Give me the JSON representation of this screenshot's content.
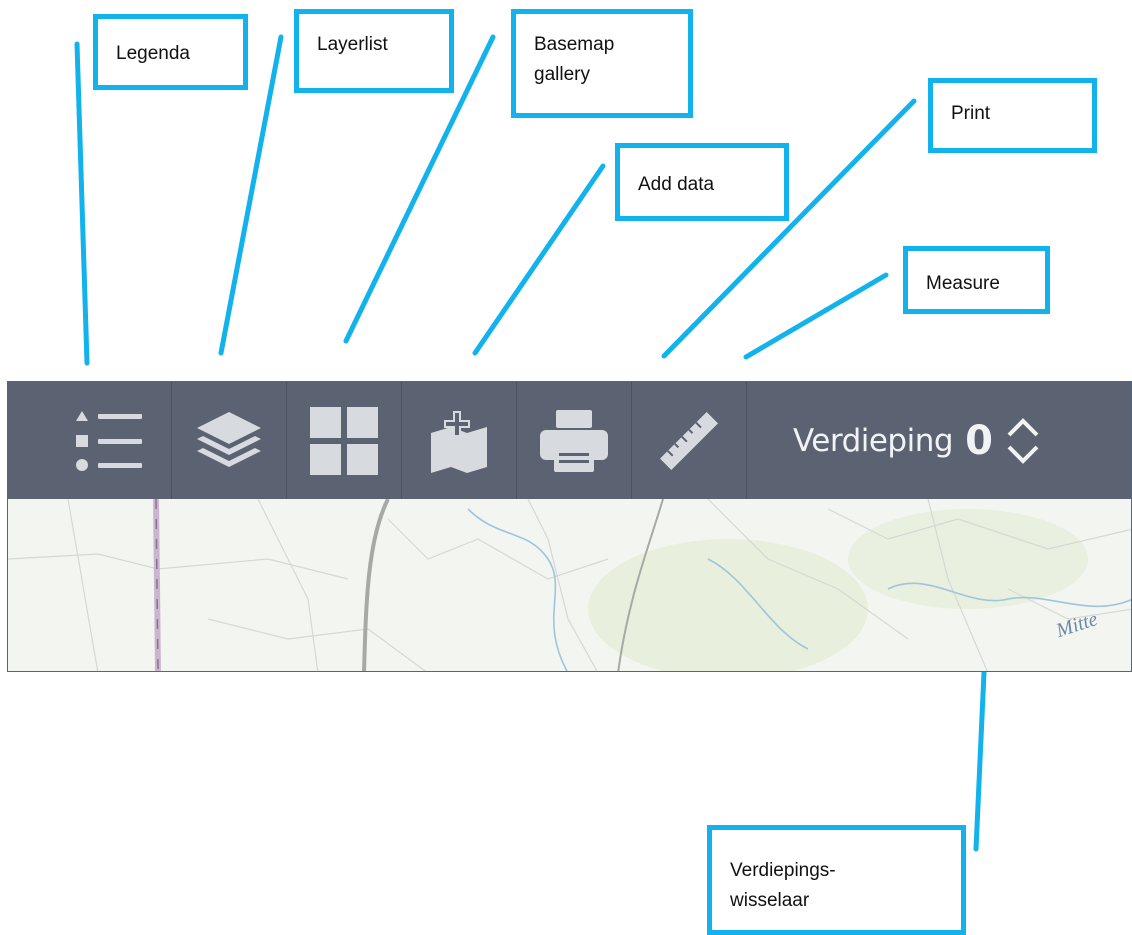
{
  "callouts": {
    "legenda": "Legenda",
    "layerlist": "Layerlist",
    "basemap_line1": "Basemap",
    "basemap_line2": "gallery",
    "add_data": "Add data",
    "print": "Print",
    "measure": "Measure",
    "floor_switch_line1": "Verdiepings-",
    "floor_switch_line2": "wisselaar"
  },
  "toolbar": {
    "tools": [
      "list-icon",
      "layers-icon",
      "grid-icon",
      "add-data-icon",
      "printer-icon",
      "ruler-icon"
    ],
    "floor_label": "Verdieping",
    "floor_value": "0"
  },
  "map": {
    "place_label": "Mitte"
  },
  "colors": {
    "callout_border": "#12b2ec",
    "toolbar_bg": "#5b6271",
    "icon": "#d7dbe0"
  }
}
